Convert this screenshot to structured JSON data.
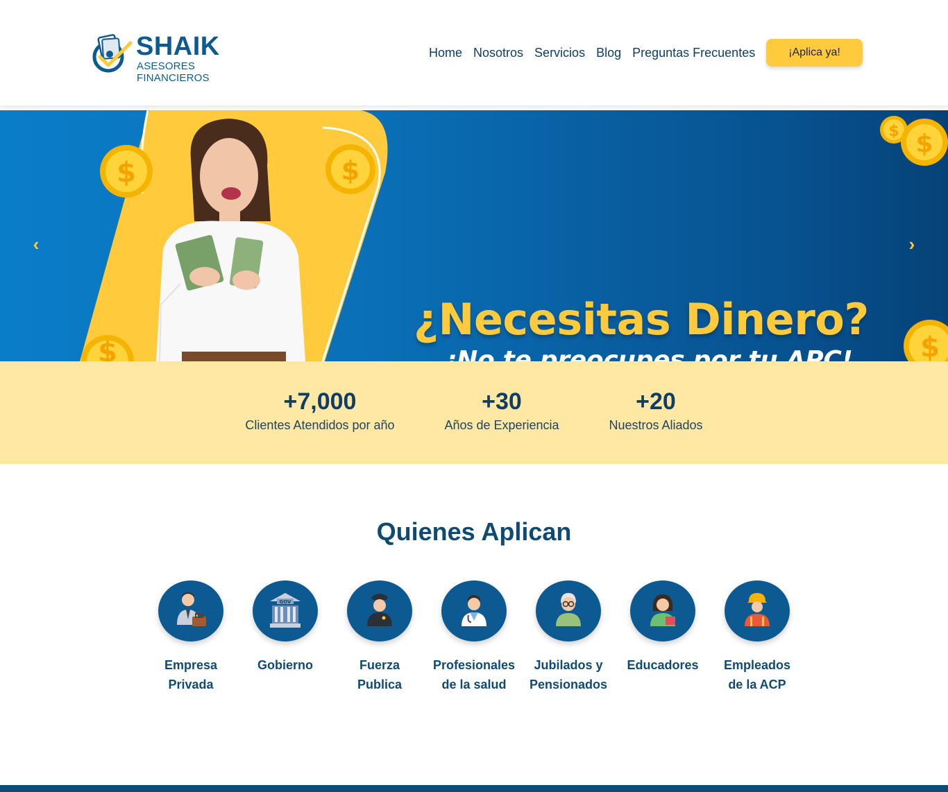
{
  "brand": {
    "name": "SHAIK",
    "tagline": "ASESORES FINANCIEROS"
  },
  "nav": {
    "items": [
      "Home",
      "Nosotros",
      "Servicios",
      "Blog",
      "Preguntas Frecuentes"
    ],
    "cta": "¡Aplica ya!"
  },
  "hero": {
    "title": "¿Necesitas Dinero?",
    "subtitle": "¡No te preocupes por tu APC!",
    "prev_icon": "chevron-left-icon",
    "next_icon": "chevron-right-icon"
  },
  "stats": [
    {
      "value": "+7,000",
      "label": "Clientes Atendidos por año"
    },
    {
      "value": "+30",
      "label": "Años de Experiencia"
    },
    {
      "value": "+20",
      "label": "Nuestros Aliados"
    }
  ],
  "applicants": {
    "title": "Quienes Aplican",
    "items": [
      {
        "line1": "Empresa",
        "line2": "Privada",
        "icon": "businessman-icon"
      },
      {
        "line1": "Gobierno",
        "line2": "",
        "icon": "government-building-icon"
      },
      {
        "line1": "Fuerza",
        "line2": "Publica",
        "icon": "police-officer-icon"
      },
      {
        "line1": "Profesionales",
        "line2": "de la salud",
        "icon": "doctor-icon"
      },
      {
        "line1": "Jubilados y",
        "line2": "Pensionados",
        "icon": "elderly-person-icon"
      },
      {
        "line1": "Educadores",
        "line2": "",
        "icon": "teacher-icon"
      },
      {
        "line1": "Empleados",
        "line2": "de la ACP",
        "icon": "construction-worker-icon"
      }
    ]
  },
  "colors": {
    "primary": "#0d5a92",
    "accent": "#ffcb3d",
    "stats_bg": "#ffe8a3"
  }
}
